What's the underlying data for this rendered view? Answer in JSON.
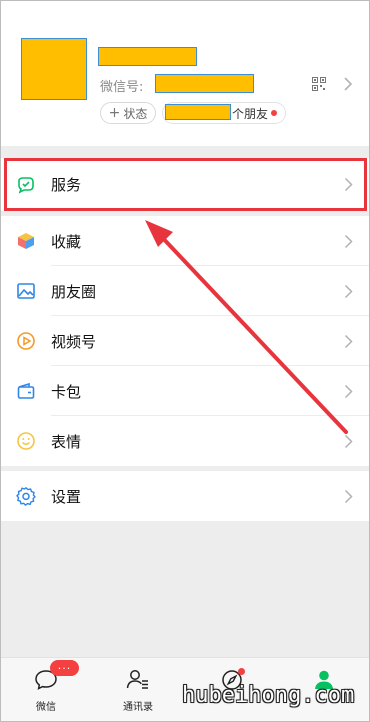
{
  "profile": {
    "wechat_id_label": "微信号:",
    "status_label": "状态",
    "status_plus": "+",
    "friends_suffix": "个朋友"
  },
  "menu": {
    "services": "服务",
    "favorites": "收藏",
    "moments": "朋友圈",
    "channels": "视频号",
    "cards": "卡包",
    "stickers": "表情",
    "settings": "设置"
  },
  "tabbar": {
    "chats": "微信",
    "contacts": "通讯录",
    "chats_badge": "···"
  },
  "watermark": "hubeihong.com",
  "colors": {
    "accent_green": "#07c160",
    "highlight_red": "#e8353d",
    "redaction_yellow": "#ffbf00",
    "badge_red": "#f44040"
  }
}
